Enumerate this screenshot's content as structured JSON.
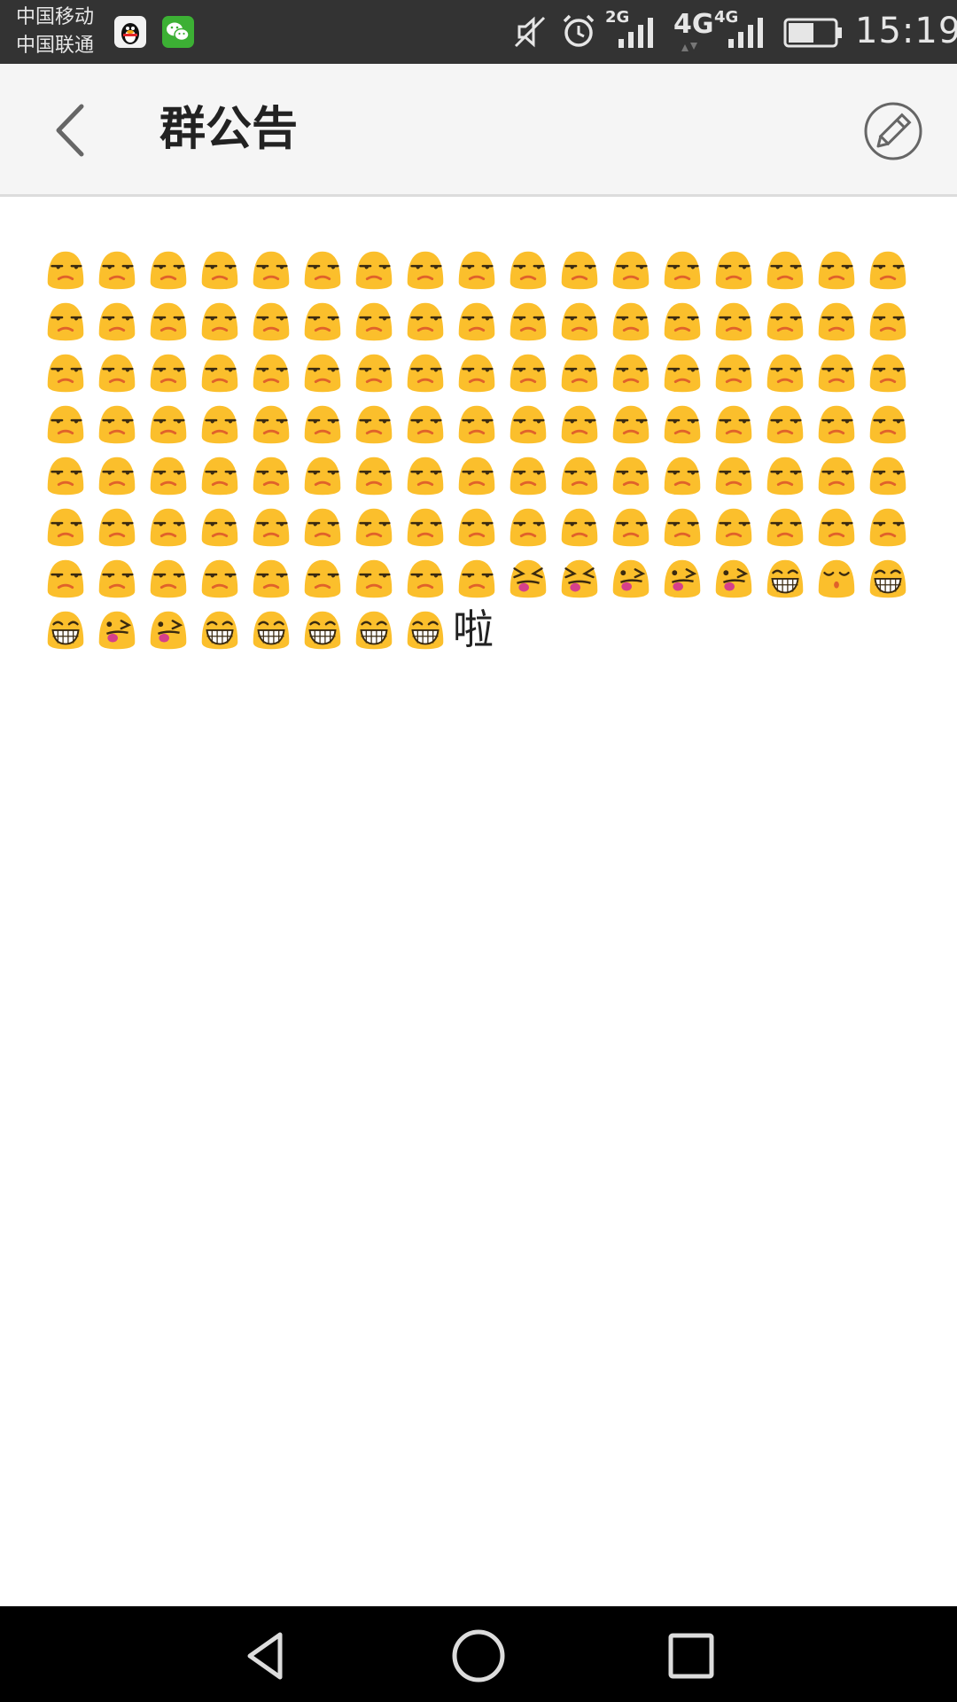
{
  "status_bar": {
    "carrier_1": "中国移动",
    "carrier_2": "中国联通",
    "net_1": "2G",
    "net_2": "4G",
    "net_3": "4G",
    "time": "15:19",
    "battery_level": 0.55,
    "icons": [
      "qq-icon",
      "wechat-icon",
      "mute-icon",
      "alarm-icon",
      "signal-icon",
      "battery-icon"
    ]
  },
  "header": {
    "title": "群公告",
    "back_icon": "chevron-left-icon",
    "edit_icon": "pencil-icon"
  },
  "announcement": {
    "emoji_sequence": [
      "unamused",
      "unamused",
      "unamused",
      "unamused",
      "unamused",
      "unamused",
      "unamused",
      "unamused",
      "unamused",
      "unamused",
      "unamused",
      "unamused",
      "unamused",
      "unamused",
      "unamused",
      "unamused",
      "unamused",
      "unamused",
      "unamused",
      "unamused",
      "unamused",
      "unamused",
      "unamused",
      "unamused",
      "unamused",
      "unamused",
      "unamused",
      "unamused",
      "unamused",
      "unamused",
      "unamused",
      "unamused",
      "unamused",
      "unamused",
      "unamused",
      "unamused",
      "unamused",
      "unamused",
      "unamused",
      "unamused",
      "unamused",
      "unamused",
      "unamused",
      "unamused",
      "unamused",
      "unamused",
      "unamused",
      "unamused",
      "unamused",
      "unamused",
      "unamused",
      "unamused",
      "unamused",
      "unamused",
      "unamused",
      "unamused",
      "unamused",
      "unamused",
      "unamused",
      "unamused",
      "unamused",
      "unamused",
      "unamused",
      "unamused",
      "unamused",
      "unamused",
      "unamused",
      "unamused",
      "unamused",
      "unamused",
      "unamused",
      "unamused",
      "unamused",
      "unamused",
      "unamused",
      "unamused",
      "unamused",
      "unamused",
      "unamused",
      "unamused",
      "unamused",
      "unamused",
      "unamused",
      "unamused",
      "unamused",
      "unamused",
      "unamused",
      "unamused",
      "unamused",
      "unamused",
      "unamused",
      "unamused",
      "unamused",
      "unamused",
      "unamused",
      "unamused",
      "unamused",
      "unamused",
      "unamused",
      "unamused",
      "unamused",
      "unamused",
      "unamused",
      "unamused",
      "unamused",
      "unamused",
      "unamused",
      "unamused",
      "unamused",
      "unamused",
      "unamused",
      "squint-tongue",
      "squint-tongue",
      "wink-tongue",
      "wink-tongue",
      "wink-tongue",
      "grin",
      "kiss",
      "grin",
      "grin",
      "wink-tongue",
      "wink-tongue",
      "grin",
      "grin",
      "grin",
      "grin",
      "grin"
    ],
    "suffix_text": "啦"
  },
  "nav_bar": {
    "icons": [
      "back-triangle-icon",
      "home-circle-icon",
      "recents-square-icon"
    ]
  },
  "colors": {
    "status_bar_bg": "#333333",
    "app_bar_bg": "#f5f5f5",
    "emoji_face": "#fbbf2c",
    "nav_bar_bg": "#000000"
  }
}
